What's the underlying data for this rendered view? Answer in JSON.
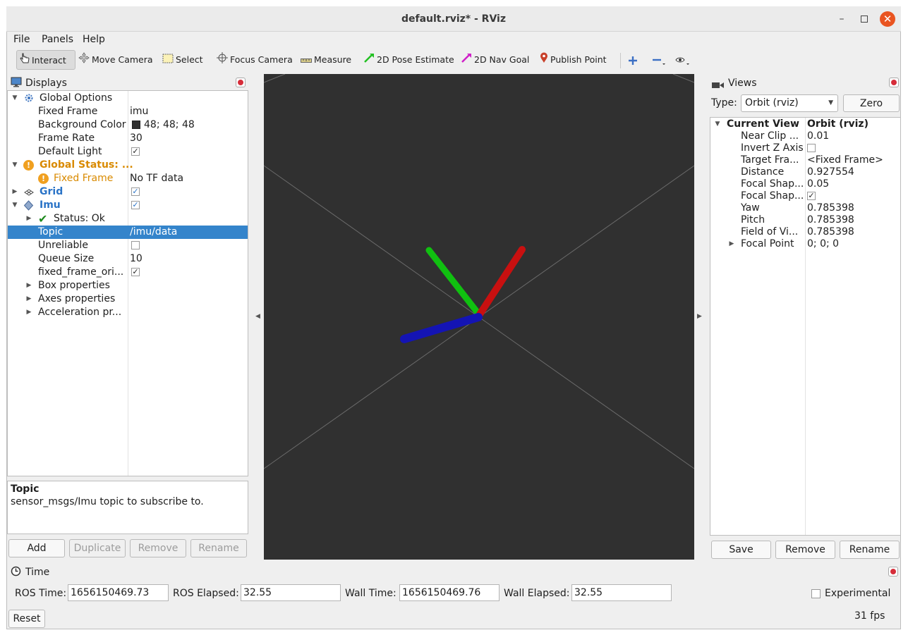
{
  "window": {
    "title": "default.rviz* - RViz"
  },
  "menu": [
    "File",
    "Panels",
    "Help"
  ],
  "toolbar": {
    "interact": "Interact",
    "move_camera": "Move Camera",
    "select": "Select",
    "focus_camera": "Focus Camera",
    "measure": "Measure",
    "pose_estimate": "2D Pose Estimate",
    "nav_goal": "2D Nav Goal",
    "publish_point": "Publish Point"
  },
  "displays": {
    "title": "Displays",
    "rows": {
      "global_options": "Global Options",
      "fixed_frame_label": "Fixed Frame",
      "fixed_frame_value": "imu",
      "bg_color_label": "Background Color",
      "bg_color_value": "48; 48; 48",
      "frame_rate_label": "Frame Rate",
      "frame_rate_value": "30",
      "default_light_label": "Default Light",
      "global_status": "Global Status: ...",
      "status_fixed_frame": "Fixed Frame",
      "status_fixed_frame_value": "No TF data",
      "grid": "Grid",
      "imu": "Imu",
      "status_ok": "Status: Ok",
      "topic_label": "Topic",
      "topic_value": "/imu/data",
      "unreliable": "Unreliable",
      "queue_size_label": "Queue Size",
      "queue_size_value": "10",
      "fixed_frame_ori": "fixed_frame_ori...",
      "box_props": "Box properties",
      "axes_props": "Axes properties",
      "accel_props": "Acceleration pr..."
    },
    "help_title": "Topic",
    "help_text": "sensor_msgs/Imu topic to subscribe to.",
    "buttons": {
      "add": "Add",
      "duplicate": "Duplicate",
      "remove": "Remove",
      "rename": "Rename"
    }
  },
  "views": {
    "title": "Views",
    "type_label": "Type:",
    "type_value": "Orbit (rviz)",
    "zero": "Zero",
    "current_view": "Current View",
    "current_view_value": "Orbit (rviz)",
    "props": [
      {
        "label": "Near Clip ...",
        "value": "0.01"
      },
      {
        "label": "Invert Z Axis",
        "value": ""
      },
      {
        "label": "Target Fra...",
        "value": "<Fixed Frame>"
      },
      {
        "label": "Distance",
        "value": "0.927554"
      },
      {
        "label": "Focal Shap...",
        "value": "0.05"
      },
      {
        "label": "Focal Shap...",
        "value": ""
      },
      {
        "label": "Yaw",
        "value": "0.785398"
      },
      {
        "label": "Pitch",
        "value": "0.785398"
      },
      {
        "label": "Field of Vi...",
        "value": "0.785398"
      },
      {
        "label": "Focal Point",
        "value": "0; 0; 0"
      }
    ],
    "buttons": {
      "save": "Save",
      "remove": "Remove",
      "rename": "Rename"
    }
  },
  "time": {
    "title": "Time",
    "ros_time_label": "ROS Time:",
    "ros_time": "1656150469.73",
    "ros_elapsed_label": "ROS Elapsed:",
    "ros_elapsed": "32.55",
    "wall_time_label": "Wall Time:",
    "wall_time": "1656150469.76",
    "wall_elapsed_label": "Wall Elapsed:",
    "wall_elapsed": "32.55",
    "experimental": "Experimental",
    "reset": "Reset",
    "fps": "31 fps"
  },
  "colors": {
    "viewport_bg": "#303030",
    "selection": "#3484cb",
    "axis_x": "#c81010",
    "axis_y": "#10c010",
    "axis_z": "#1414b4"
  }
}
